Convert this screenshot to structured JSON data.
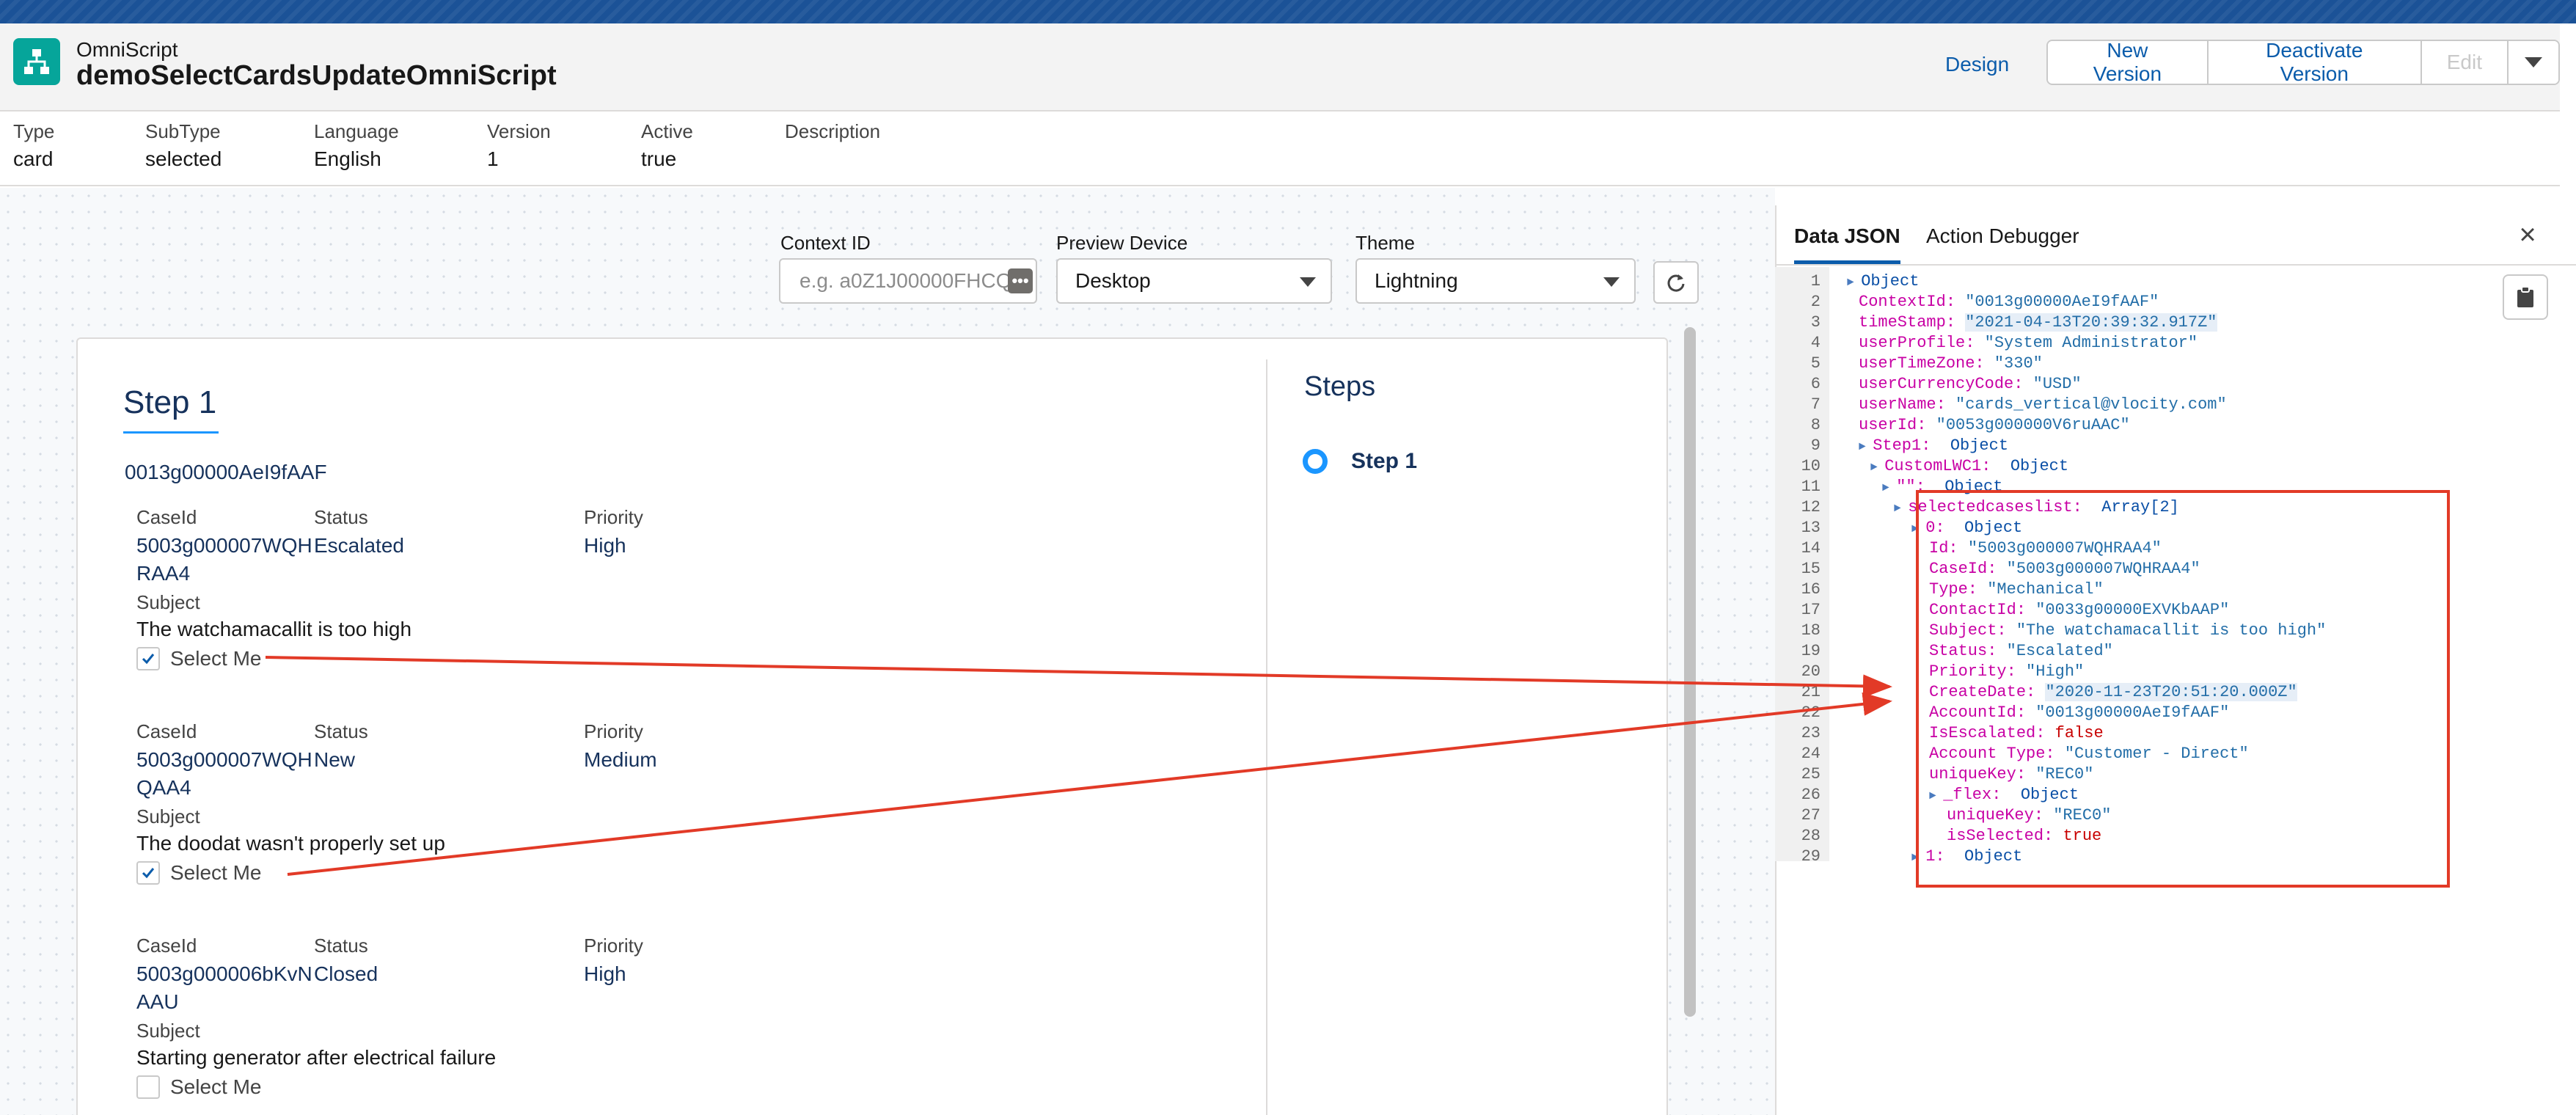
{
  "header": {
    "object_label": "OmniScript",
    "title": "demoSelectCardsUpdateOmniScript",
    "buttons": {
      "design": "Design",
      "new_version": "New Version",
      "deactivate": "Deactivate Version",
      "edit": "Edit"
    },
    "fields": [
      {
        "label": "Type",
        "value": "card"
      },
      {
        "label": "SubType",
        "value": "selected"
      },
      {
        "label": "Language",
        "value": "English"
      },
      {
        "label": "Version",
        "value": "1"
      },
      {
        "label": "Active",
        "value": "true"
      },
      {
        "label": "Description",
        "value": ""
      }
    ]
  },
  "preview": {
    "context_label": "Context ID",
    "context_placeholder": "e.g. a0Z1J00000FHCQe",
    "device_label": "Preview Device",
    "device_value": "Desktop",
    "theme_label": "Theme",
    "theme_value": "Lightning"
  },
  "form": {
    "step_title": "Step 1",
    "account_id": "0013g00000AeI9fAAF",
    "col_labels": {
      "caseid": "CaseId",
      "status": "Status",
      "priority": "Priority",
      "subject": "Subject"
    },
    "select_label": "Select Me",
    "cards": [
      {
        "caseid_line1": "5003g000007WQH",
        "caseid_line2": "RAA4",
        "status": "Escalated",
        "priority": "High",
        "subject": "The watchamacallit is too high",
        "selected": true
      },
      {
        "caseid_line1": "5003g000007WQH",
        "caseid_line2": "QAA4",
        "status": "New",
        "priority": "Medium",
        "subject": "The doodat wasn't properly set up",
        "selected": true
      },
      {
        "caseid_line1": "5003g000006bKvN",
        "caseid_line2": "AAU",
        "status": "Closed",
        "priority": "High",
        "subject": "Starting generator after electrical failure",
        "selected": false
      }
    ],
    "steps_title": "Steps",
    "steps": [
      "Step 1"
    ]
  },
  "debugger": {
    "tabs": [
      "Data JSON",
      "Action Debugger"
    ],
    "active_tab": "Data JSON",
    "lines": [
      {
        "n": "1",
        "indent": 0,
        "tri": true,
        "key": "",
        "val": "Object",
        "type": "obj"
      },
      {
        "n": "2",
        "indent": 1,
        "key": "ContextId: ",
        "val": "\"0013g00000AeI9fAAF\"",
        "type": "str"
      },
      {
        "n": "3",
        "indent": 1,
        "key": "timeStamp: ",
        "val": "\"2021-04-13T20:39:32.917Z\"",
        "type": "str",
        "hl": true
      },
      {
        "n": "4",
        "indent": 1,
        "key": "userProfile: ",
        "val": "\"System Administrator\"",
        "type": "str"
      },
      {
        "n": "5",
        "indent": 1,
        "key": "userTimeZone: ",
        "val": "\"330\"",
        "type": "str"
      },
      {
        "n": "6",
        "indent": 1,
        "key": "userCurrencyCode: ",
        "val": "\"USD\"",
        "type": "str"
      },
      {
        "n": "7",
        "indent": 1,
        "key": "userName: ",
        "val": "\"cards_vertical@vlocity.com\"",
        "type": "str"
      },
      {
        "n": "8",
        "indent": 1,
        "key": "userId: ",
        "val": "\"0053g000000V6ruAAC\"",
        "type": "str"
      },
      {
        "n": "9",
        "indent": 1,
        "tri": true,
        "key": "Step1:  ",
        "val": "Object",
        "type": "obj"
      },
      {
        "n": "10",
        "indent": 2,
        "tri": true,
        "key": "CustomLWC1:  ",
        "val": "Object",
        "type": "obj"
      },
      {
        "n": "11",
        "indent": 3,
        "tri": true,
        "key": "\"\":  ",
        "val": "Object",
        "type": "obj"
      },
      {
        "n": "12",
        "indent": 4,
        "tri": true,
        "key": "selectedcaseslist:  ",
        "val": "Array[2]",
        "type": "arr"
      },
      {
        "n": "13",
        "indent": 5,
        "tri": true,
        "key": "0:  ",
        "val": "Object",
        "type": "obj"
      },
      {
        "n": "14",
        "indent": 6,
        "key": "Id: ",
        "val": "\"5003g000007WQHRAA4\"",
        "type": "str"
      },
      {
        "n": "15",
        "indent": 6,
        "key": "CaseId: ",
        "val": "\"5003g000007WQHRAA4\"",
        "type": "str"
      },
      {
        "n": "16",
        "indent": 6,
        "key": "Type: ",
        "val": "\"Mechanical\"",
        "type": "str"
      },
      {
        "n": "17",
        "indent": 6,
        "key": "ContactId: ",
        "val": "\"0033g00000EXVKbAAP\"",
        "type": "str"
      },
      {
        "n": "18",
        "indent": 6,
        "key": "Subject: ",
        "val": "\"The watchamacallit is too high\"",
        "type": "str"
      },
      {
        "n": "19",
        "indent": 6,
        "key": "Status: ",
        "val": "\"Escalated\"",
        "type": "str"
      },
      {
        "n": "20",
        "indent": 6,
        "key": "Priority: ",
        "val": "\"High\"",
        "type": "str"
      },
      {
        "n": "21",
        "indent": 6,
        "key": "CreateDate: ",
        "val": "\"2020-11-23T20:51:20.000Z\"",
        "type": "str",
        "hl": true
      },
      {
        "n": "22",
        "indent": 6,
        "key": "AccountId: ",
        "val": "\"0013g00000AeI9fAAF\"",
        "type": "str"
      },
      {
        "n": "23",
        "indent": 6,
        "key": "IsEscalated: ",
        "val": "false",
        "type": "bool"
      },
      {
        "n": "24",
        "indent": 6,
        "key": "Account Type: ",
        "val": "\"Customer - Direct\"",
        "type": "str"
      },
      {
        "n": "25",
        "indent": 6,
        "key": "uniqueKey: ",
        "val": "\"REC0\"",
        "type": "str"
      },
      {
        "n": "26",
        "indent": 6,
        "tri": true,
        "key": "_flex:  ",
        "val": "Object",
        "type": "obj"
      },
      {
        "n": "27",
        "indent": 7,
        "key": "uniqueKey: ",
        "val": "\"REC0\"",
        "type": "str"
      },
      {
        "n": "28",
        "indent": 7,
        "key": "isSelected: ",
        "val": "true",
        "type": "bool"
      },
      {
        "n": "29",
        "indent": 5,
        "tri": true,
        "key": "1:  ",
        "val": "Object",
        "type": "obj"
      }
    ]
  },
  "colors": {
    "brand_blue": "#1b5297",
    "link_blue": "#0b5cab",
    "app_icon": "#06a59a",
    "annotation_red": "#e23a27",
    "json_key": "#c800a4",
    "json_string": "#1a1aa6",
    "json_bool": "#c80000"
  }
}
